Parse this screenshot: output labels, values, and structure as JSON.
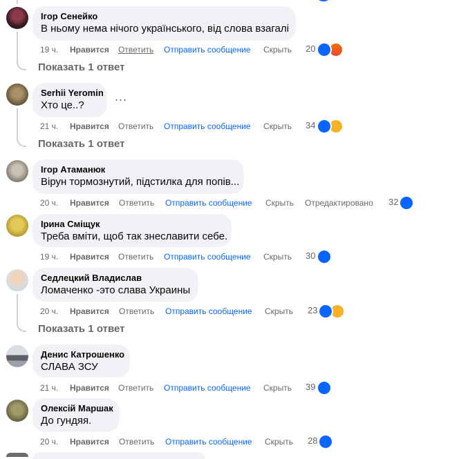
{
  "actions": {
    "like": "Нравится",
    "reply": "Ответить",
    "message": "Отправить сообщение",
    "hide": "Скрыть"
  },
  "comments": [
    {
      "author": "Ігор Сенейко",
      "text": "В ньому нема нічого українського, від слова взагалі",
      "time": "19 ч.",
      "count": "20",
      "reactions": [
        "like-icon",
        "angry-icon"
      ],
      "replies_label": "Показать 1 ответ"
    },
    {
      "author": "Serhii Yeromin",
      "text": "Хто це..?",
      "time": "21 ч.",
      "count": "34",
      "reactions": [
        "like-icon",
        "haha-icon"
      ],
      "replies_label": "Показать 1 ответ",
      "more": "..."
    },
    {
      "author": "Ігор Атаманюк",
      "text": "Вірун тормознутий, підстилка для попів...",
      "time": "20 ч.",
      "count": "32",
      "edited": "Отредактировано",
      "reactions": [
        "like-icon"
      ]
    },
    {
      "author": "Ірина Сміщук",
      "text": "Треба вміти, щоб так знеславити себе.",
      "time": "19 ч.",
      "count": "30",
      "reactions": [
        "like-icon"
      ]
    },
    {
      "author": "Седлецкий Владислав",
      "text": "Ломаченко -это слава Украины",
      "time": "20 ч.",
      "count": "23",
      "reactions": [
        "like-icon",
        "haha-icon"
      ],
      "replies_label": "Показать 1 ответ"
    },
    {
      "author": "Денис Катрошенко",
      "text": "СЛАВА ЗСУ",
      "time": "21 ч.",
      "count": "39",
      "reactions": [
        "like-icon"
      ]
    },
    {
      "author": "Олексій Маршак",
      "text": "До гундяя.",
      "time": "20 ч.",
      "count": "28",
      "reactions": [
        "like-icon"
      ]
    }
  ],
  "colors": {
    "link": "#0866ff",
    "muted": "#65676b",
    "bubble": "#f0f2f5",
    "like": "#0866ff",
    "angry": "#e9710f",
    "haha": "#f7b125"
  }
}
